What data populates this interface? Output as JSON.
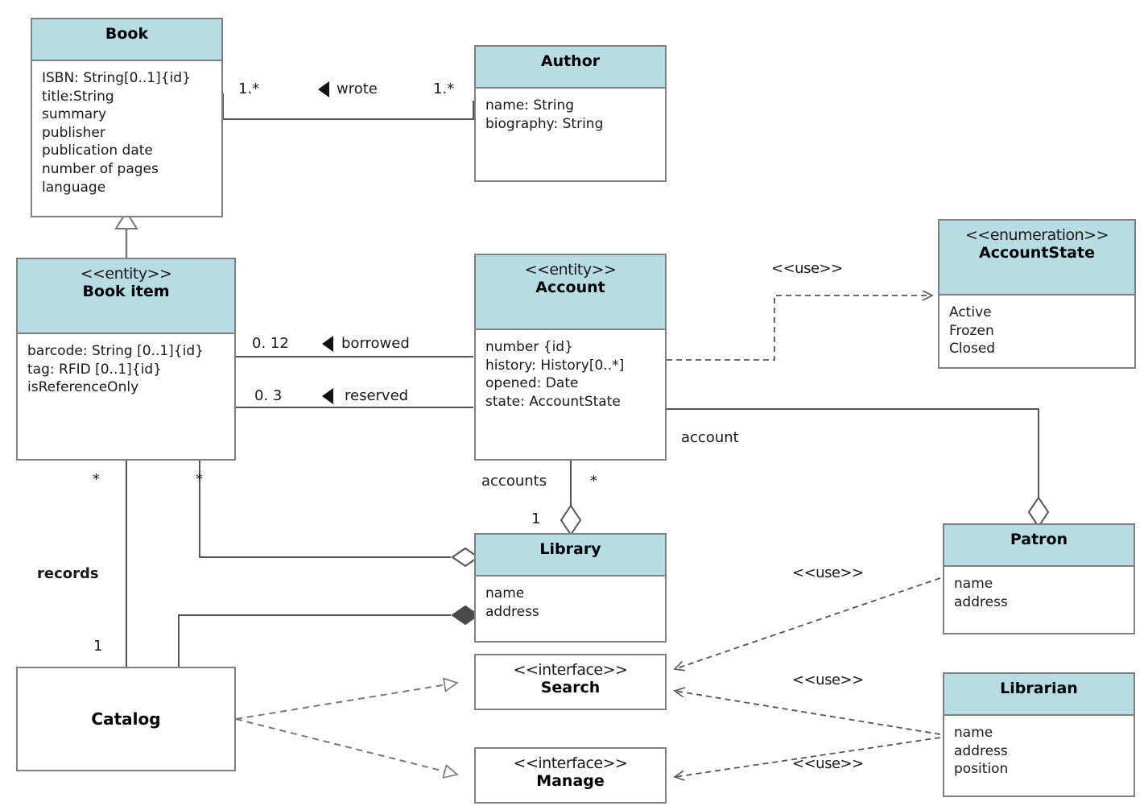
{
  "diagram": {
    "title": "Library Management System UML Class Diagram",
    "type": "uml-class-diagram",
    "colors": {
      "header_fill": "#b7dce4",
      "box_border": "#808080",
      "line": "#555555",
      "text": "#1a1a1a",
      "background": "#ffffff"
    }
  },
  "classes": {
    "book": {
      "stereotype": "",
      "name": "Book",
      "attributes": [
        "ISBN: String[0..1]{id}",
        "title:String",
        "summary",
        "publisher",
        "publication date",
        "number of pages",
        "language"
      ]
    },
    "author": {
      "stereotype": "",
      "name": "Author",
      "attributes": [
        "name: String",
        "biography: String"
      ]
    },
    "book_item": {
      "stereotype": "<<entity>>",
      "name": "Book item",
      "attributes": [
        "barcode: String [0..1]{id}",
        "tag: RFID [0..1]{id}",
        "isReferenceOnly"
      ]
    },
    "account": {
      "stereotype": "<<entity>>",
      "name": "Account",
      "attributes": [
        "number {id}",
        "history: History[0..*]",
        "opened: Date",
        "state: AccountState"
      ]
    },
    "account_state": {
      "stereotype": "<<enumeration>>",
      "name": "AccountState",
      "attributes": [
        "Active",
        "Frozen",
        "Closed"
      ]
    },
    "library": {
      "stereotype": "",
      "name": "Library",
      "attributes": [
        "name",
        "address"
      ]
    },
    "patron": {
      "stereotype": "",
      "name": "Patron",
      "attributes": [
        "name",
        "address"
      ]
    },
    "librarian": {
      "stereotype": "",
      "name": "Librarian",
      "attributes": [
        "name",
        "address",
        "position"
      ]
    },
    "search": {
      "stereotype": "<<interface>>",
      "name": "Search",
      "attributes": []
    },
    "manage": {
      "stereotype": "<<interface>>",
      "name": "Manage",
      "attributes": []
    },
    "catalog": {
      "stereotype": "",
      "name": "Catalog",
      "attributes": []
    }
  },
  "relationships": {
    "book_author": {
      "name": "wrote",
      "source_multiplicity": "1.*",
      "target_multiplicity": "1.*",
      "kind": "association",
      "direction": "left"
    },
    "bookitem_account_borrowed": {
      "name": "borrowed",
      "source_multiplicity": "0. 12",
      "kind": "association",
      "direction": "left"
    },
    "bookitem_account_reserved": {
      "name": "reserved",
      "source_multiplicity": "0. 3",
      "kind": "association",
      "direction": "left"
    },
    "account_accountstate": {
      "name": "<<use>>",
      "kind": "dependency"
    },
    "account_library": {
      "role": "accounts",
      "source_multiplicity": "*",
      "target_multiplicity": "1",
      "kind": "aggregation"
    },
    "account_patron": {
      "role": "account",
      "kind": "aggregation"
    },
    "bookitem_library": {
      "source_multiplicity": "*",
      "kind": "aggregation"
    },
    "bookitem_catalog": {
      "role": "records",
      "source_multiplicity": "*",
      "target_multiplicity": "1",
      "kind": "association"
    },
    "catalog_library": {
      "kind": "composition"
    },
    "catalog_search": {
      "kind": "realization"
    },
    "catalog_manage": {
      "kind": "realization"
    },
    "patron_search": {
      "name": "<<use>>",
      "kind": "dependency"
    },
    "librarian_search": {
      "name": "<<use>>",
      "kind": "dependency"
    },
    "librarian_manage": {
      "name": "<<use>>",
      "kind": "dependency"
    }
  },
  "floating_labels": {
    "wrote": "wrote",
    "wrote_left_mult": "1.*",
    "wrote_right_mult": "1.*",
    "borrowed": "borrowed",
    "borrowed_mult": "0. 12",
    "reserved": "reserved",
    "reserved_mult": "0. 3",
    "use_accountstate": "<<use>>",
    "use_patron_search": "<<use>>",
    "use_librarian_search": "<<use>>",
    "use_librarian_manage": "<<use>>",
    "account_role": "account",
    "accounts_role": "accounts",
    "accounts_star": "*",
    "library_one": "1",
    "records": "records",
    "records_star": "*",
    "records_one": "1",
    "bookitem_library_star": "*"
  }
}
